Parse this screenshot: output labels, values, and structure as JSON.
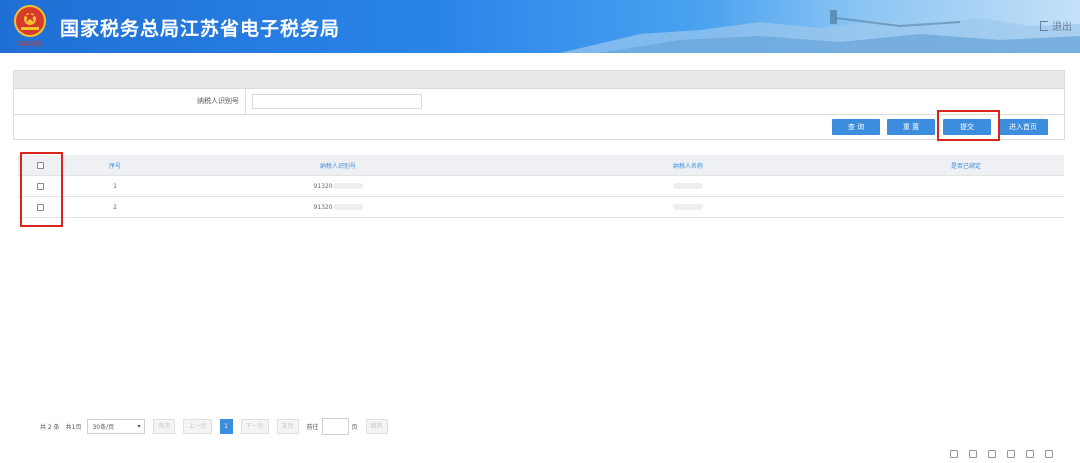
{
  "header": {
    "title": "国家税务总局江苏省电子税务局",
    "emblem_caption": "中国税务",
    "logout_label": "退出"
  },
  "form": {
    "tin_label": "纳税人识别号",
    "tin_value": ""
  },
  "buttons": {
    "query": "查 询",
    "reset": "重 置",
    "submit": "提交",
    "home": "进入首页"
  },
  "table": {
    "columns": [
      "序号",
      "纳税人识别号",
      "纳税人名称",
      "是否已绑定"
    ],
    "rows": [
      {
        "index": "1",
        "tin": "91320",
        "name": "",
        "bound": ""
      },
      {
        "index": "2",
        "tin": "91320",
        "name": "",
        "bound": ""
      }
    ]
  },
  "pager": {
    "total": "共 2 条",
    "pages": "共1页",
    "page_size": "30条/页",
    "first": "首页",
    "prev": "上一页",
    "current": "1",
    "next": "下一页",
    "last": "末页",
    "goto_label": "前往",
    "page_unit": "页",
    "jump": "跳转"
  },
  "colors": {
    "accent": "#3c8dde",
    "highlight": "#d9251c",
    "banner": "#2a84e8"
  }
}
